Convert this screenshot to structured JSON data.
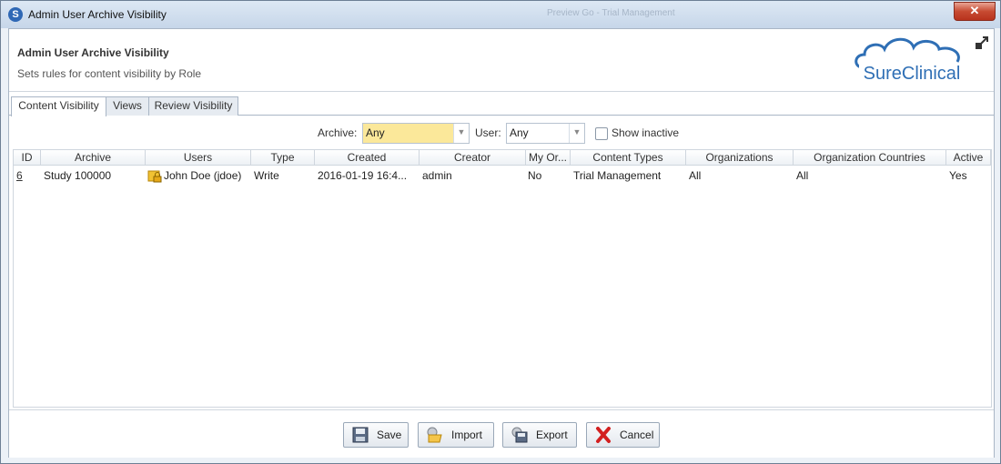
{
  "window": {
    "title": "Admin User Archive Visibility",
    "background_ghost_text": "Preview Go - Trial Management"
  },
  "header": {
    "title": "Admin User Archive Visibility",
    "subtitle": "Sets rules for content visibility by Role",
    "logo_text": "SureClinical"
  },
  "tabs": [
    {
      "label": "Content Visibility",
      "active": true
    },
    {
      "label": "Views",
      "active": false
    },
    {
      "label": "Review Visibility",
      "active": false
    }
  ],
  "filters": {
    "archive_label": "Archive:",
    "archive_value": "Any",
    "user_label": "User:",
    "user_value": "Any",
    "show_inactive_label": "Show inactive",
    "show_inactive_checked": false
  },
  "table": {
    "columns": [
      "ID",
      "Archive",
      "Users",
      "Type",
      "Created",
      "Creator",
      "My Or...",
      "Content Types",
      "Organizations",
      "Organization Countries",
      "Active"
    ],
    "rows": [
      {
        "id": "6",
        "archive": "Study 100000",
        "users": "John Doe (jdoe)",
        "type": "Write",
        "created": "2016-01-19 16:4...",
        "creator": "admin",
        "my_org": "No",
        "content_types": "Trial Management",
        "organizations": "All",
        "org_countries": "All",
        "active": "Yes"
      }
    ]
  },
  "buttons": {
    "save": "Save",
    "import": "Import",
    "export": "Export",
    "cancel": "Cancel"
  },
  "colors": {
    "accent": "#2f6fb5",
    "archive_combo_bg": "#fbe89a",
    "close_red": "#c74b32"
  }
}
